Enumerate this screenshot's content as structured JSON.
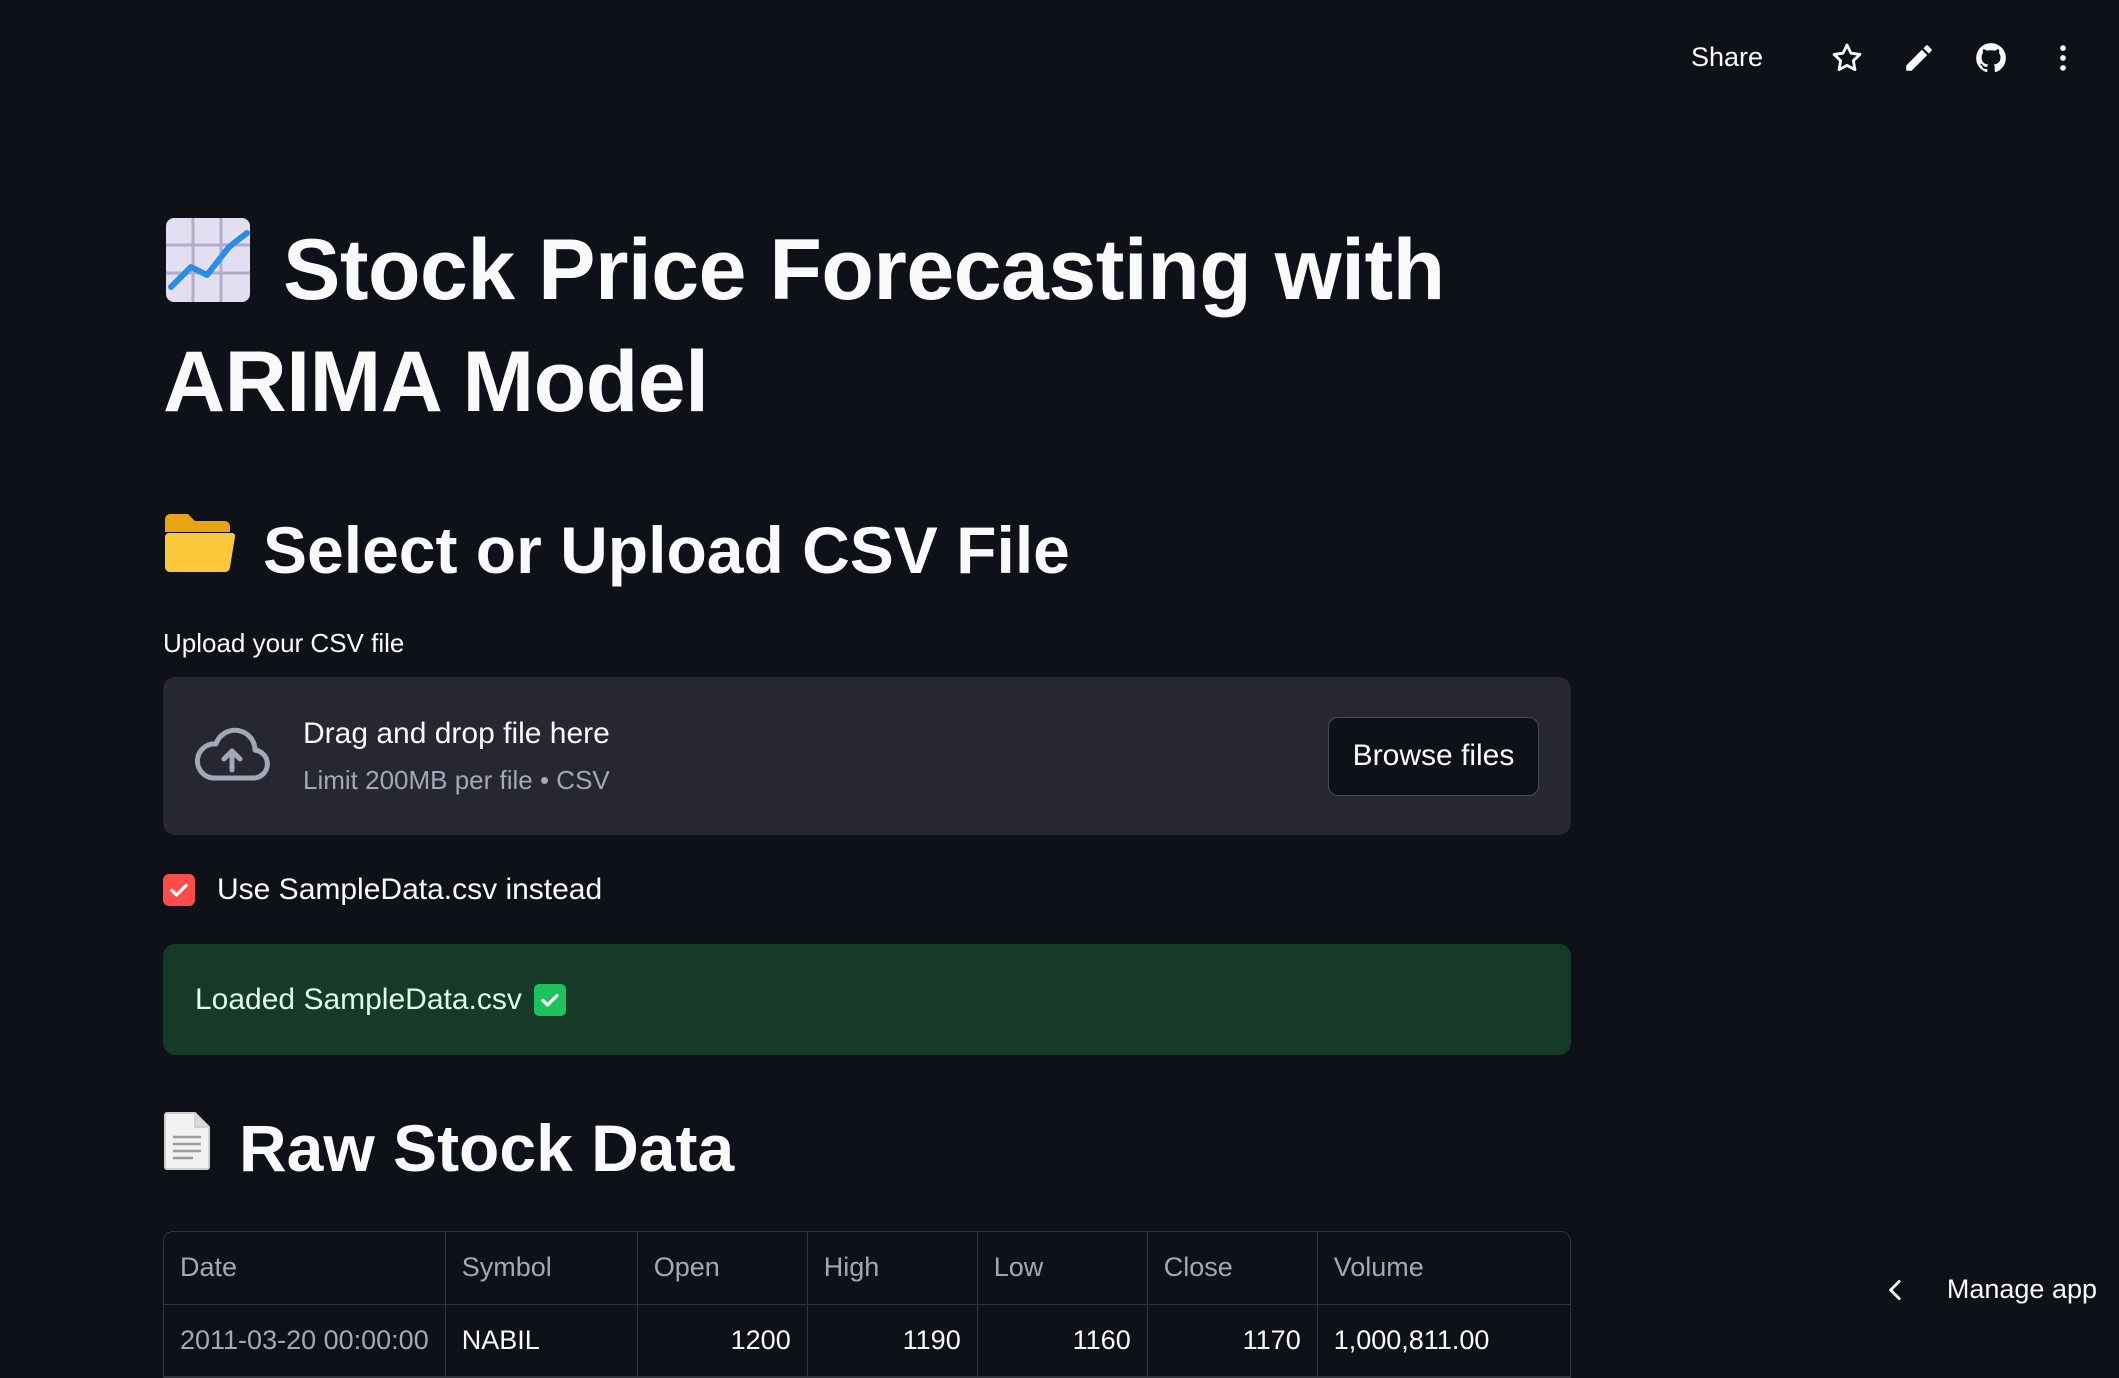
{
  "toolbar": {
    "share_label": "Share",
    "icons": [
      "star-icon",
      "pencil-icon",
      "github-icon",
      "more-vertical-icon"
    ]
  },
  "title": {
    "emoji": "chart-increasing-icon",
    "text": "Stock Price Forecasting with ARIMA Model"
  },
  "upload_section": {
    "emoji": "open-folder-icon",
    "heading": "Select or Upload CSV File",
    "label": "Upload your CSV file",
    "dropzone": {
      "main_text": "Drag and drop file here",
      "sub_text": "Limit 200MB per file • CSV",
      "browse_label": "Browse files"
    },
    "checkbox": {
      "label": "Use SampleData.csv instead",
      "checked": true,
      "accent_color": "#ff4b4b"
    },
    "success": {
      "text": "Loaded SampleData.csv",
      "background": "#173928"
    }
  },
  "raw_section": {
    "emoji": "document-icon",
    "heading": "Raw Stock Data",
    "table": {
      "headers": [
        "Date",
        "Symbol",
        "Open",
        "High",
        "Low",
        "Close",
        "Volume"
      ],
      "rows": [
        [
          "2011-03-20 00:00:00",
          "NABIL",
          "1200",
          "1190",
          "1160",
          "1170",
          "1,000,811.00"
        ]
      ]
    }
  },
  "manage_app": {
    "label": "Manage app"
  }
}
